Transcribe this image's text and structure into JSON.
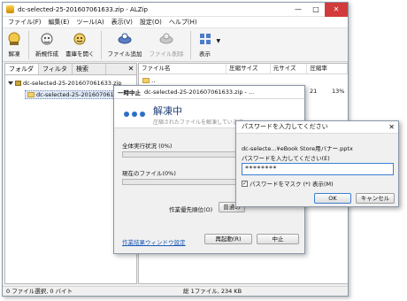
{
  "window": {
    "title": "dc-selected-25-201607061633.zip - ALZip",
    "minimize": "—",
    "maximize": "□",
    "close": "✕"
  },
  "menu": [
    "ファイル(F)",
    "編集(E)",
    "ツール(A)",
    "表示(V)",
    "設定(O)",
    "ヘルプ(H)"
  ],
  "toolbar": [
    {
      "label": "解凍",
      "icon": "extract-icon",
      "enabled": true
    },
    {
      "label": "新規作成",
      "icon": "new-archive-icon",
      "enabled": true
    },
    {
      "label": "書庫を開く",
      "icon": "open-archive-icon",
      "enabled": true
    },
    {
      "label": "ファイル追加",
      "icon": "add-file-icon",
      "enabled": true
    },
    {
      "label": "ファイル削除",
      "icon": "delete-file-icon",
      "enabled": false
    },
    {
      "label": "表示",
      "icon": "view-icon",
      "enabled": true
    }
  ],
  "left_tabs": [
    "フォルダ",
    "フィルタ",
    "検索"
  ],
  "tree": {
    "root": "dc-selected-25-201607061633.zip",
    "child": "dc-selected-25-201607061633"
  },
  "columns": [
    "ファイル名",
    "圧縮サイズ",
    "元サイズ",
    "圧縮率"
  ],
  "file_row": {
    "name": "..",
    "size_fragment": "21",
    "ratio": "13%"
  },
  "status": {
    "left": "0 ファイル選択, 0 バイト",
    "center": "総 1ファイル, 234 KB"
  },
  "extract_dialog": {
    "title_prefix": "一時中止",
    "title": "dc-selected-25-201607061633.zip - ...",
    "heading": "解凍中",
    "subheading": "圧縮されたファイルを解凍しています。",
    "overall_label": "全体実行状況 (0%)",
    "overall_progress": 0,
    "current_label": "現在のファイル(0%)",
    "current_progress": 0,
    "priority_label": "作業優先順位(O)",
    "priority_value": "普通の",
    "link": "作業結果ウィンドウ設定",
    "restart": "再起動(R)",
    "stop": "中止"
  },
  "password_dialog": {
    "title": "パスワードを入力してください",
    "close": "✕",
    "file": "dc-selecte...¥eBook Store用バナー.pptx",
    "prompt": "パスワードを入力してください(E)",
    "value": "********",
    "mask_label": "パスワードをマスク (*) 表示(M)",
    "mask_checked": true,
    "ok": "OK",
    "cancel": "キャンセル"
  }
}
